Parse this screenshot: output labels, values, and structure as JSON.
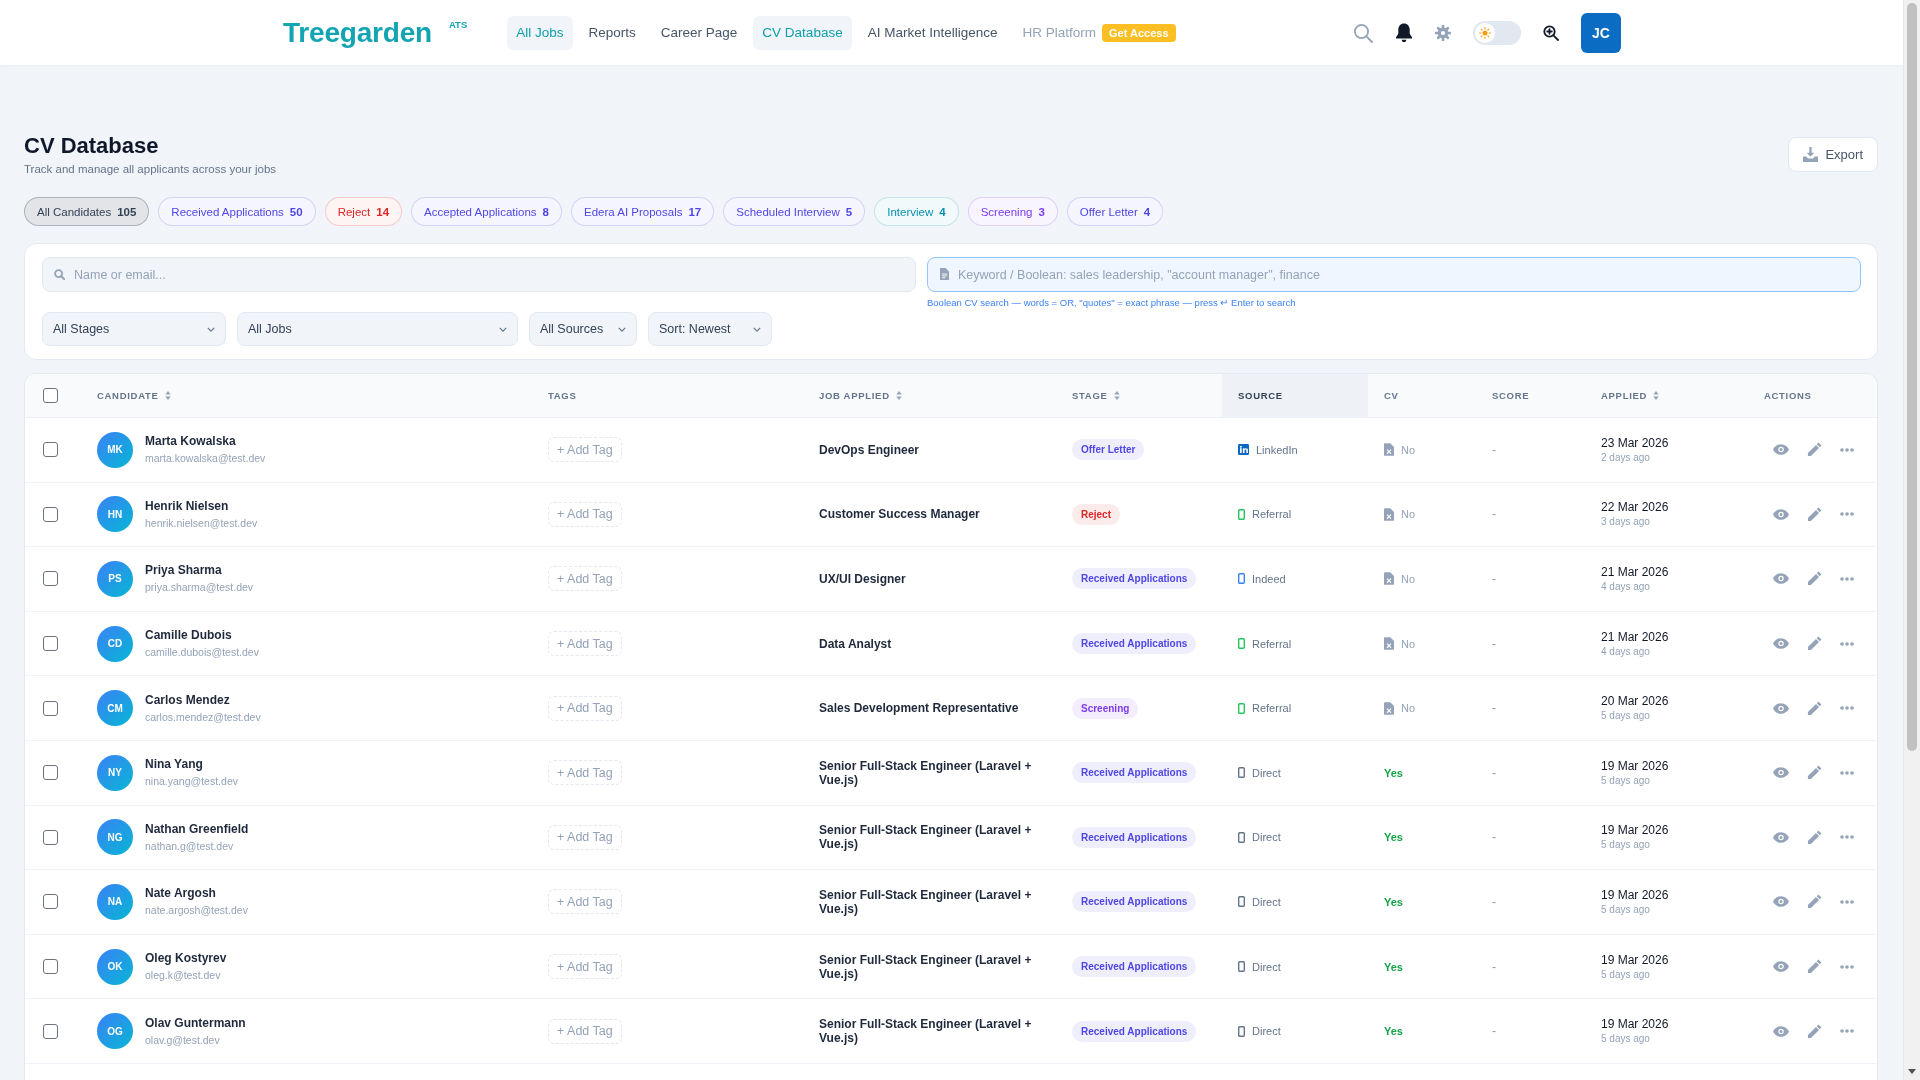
{
  "header": {
    "logo": "Treegarden",
    "logo_badge": "ATS",
    "nav": [
      {
        "label": "All Jobs",
        "selected": true,
        "disabled": false
      },
      {
        "label": "Reports",
        "selected": false,
        "disabled": false
      },
      {
        "label": "Career Page",
        "selected": false,
        "disabled": false
      },
      {
        "label": "CV Database",
        "selected": true,
        "disabled": false
      },
      {
        "label": "AI Market Intelligence",
        "selected": false,
        "disabled": false
      },
      {
        "label": "HR Platform",
        "selected": false,
        "disabled": true,
        "badge": "Get Access"
      }
    ],
    "theme_toggle": {
      "on": false
    },
    "user_initials": "JC"
  },
  "page": {
    "title": "CV Database",
    "subtitle": "Track and manage all applicants across your jobs",
    "export_button": "Export"
  },
  "stage_filters": [
    {
      "label": "All Candidates",
      "count": "105",
      "selected": true,
      "color": "#334155"
    },
    {
      "label": "Received Applications",
      "count": "50",
      "selected": false,
      "color": "#4f46e5"
    },
    {
      "label": "Reject",
      "count": "14",
      "selected": false,
      "color": "#dc2626"
    },
    {
      "label": "Accepted Applications",
      "count": "8",
      "selected": false,
      "color": "#4f46e5"
    },
    {
      "label": "Edera AI Proposals",
      "count": "17",
      "selected": false,
      "color": "#4f46e5"
    },
    {
      "label": "Scheduled Interview",
      "count": "5",
      "selected": false,
      "color": "#4f46e5"
    },
    {
      "label": "Interview",
      "count": "4",
      "selected": false,
      "color": "#0891b2"
    },
    {
      "label": "Screening",
      "count": "3",
      "selected": false,
      "color": "#7c3aed"
    },
    {
      "label": "Offer Letter",
      "count": "4",
      "selected": false,
      "color": "#4f46e5"
    }
  ],
  "filters": {
    "name_search": {
      "placeholder": "Name or email..."
    },
    "keyword_search": {
      "placeholder": "Keyword / Boolean: sales leadership, \"account manager\", finance",
      "hint": "Boolean CV search — words = OR, \"quotes\" = exact phrase — press ↵ Enter to search"
    },
    "dropdowns": [
      {
        "value": "All Stages"
      },
      {
        "value": "All Jobs"
      },
      {
        "value": "All Sources"
      },
      {
        "value": "Sort: Newest"
      }
    ]
  },
  "table": {
    "select_all": {
      "checked": false
    },
    "columns": [
      {
        "label": "CANDIDATE",
        "sortable": true,
        "highlighted": false
      },
      {
        "label": "TAGS",
        "sortable": false,
        "highlighted": false
      },
      {
        "label": "JOB APPLIED",
        "sortable": true,
        "highlighted": false
      },
      {
        "label": "STAGE",
        "sortable": true,
        "highlighted": false
      },
      {
        "label": "SOURCE",
        "sortable": false,
        "highlighted": true
      },
      {
        "label": "CV",
        "sortable": false,
        "highlighted": false
      },
      {
        "label": "SCORE",
        "sortable": false,
        "highlighted": false
      },
      {
        "label": "APPLIED",
        "sortable": true,
        "highlighted": false
      },
      {
        "label": "ACTIONS",
        "sortable": false,
        "highlighted": false
      }
    ],
    "rows": [
      {
        "checked": false,
        "initials": "MK",
        "name": "Marta Kowalska",
        "email": "marta.kowalska@test.dev",
        "tag_action": "+ Add Tag",
        "job": "DevOps Engineer",
        "stage": {
          "label": "Offer Letter",
          "color": "#4f46e5"
        },
        "source": {
          "label": "LinkedIn",
          "kind": "linkedin",
          "color": "#0a66c2"
        },
        "cv": {
          "label": "No",
          "attached": false
        },
        "score": "-",
        "applied_date": "23 Mar 2026",
        "applied_ago": "2 days ago"
      },
      {
        "checked": false,
        "initials": "HN",
        "name": "Henrik Nielsen",
        "email": "henrik.nielsen@test.dev",
        "tag_action": "+ Add Tag",
        "job": "Customer Success Manager",
        "stage": {
          "label": "Reject",
          "color": "#dc2626"
        },
        "source": {
          "label": "Referral",
          "kind": "device",
          "color": "#22c55e"
        },
        "cv": {
          "label": "No",
          "attached": false
        },
        "score": "-",
        "applied_date": "22 Mar 2026",
        "applied_ago": "3 days ago"
      },
      {
        "checked": false,
        "initials": "PS",
        "name": "Priya Sharma",
        "email": "priya.sharma@test.dev",
        "tag_action": "+ Add Tag",
        "job": "UX/UI Designer",
        "stage": {
          "label": "Received Applications",
          "color": "#4f46e5"
        },
        "source": {
          "label": "Indeed",
          "kind": "device",
          "color": "#3b82f6"
        },
        "cv": {
          "label": "No",
          "attached": false
        },
        "score": "-",
        "applied_date": "21 Mar 2026",
        "applied_ago": "4 days ago"
      },
      {
        "checked": false,
        "initials": "CD",
        "name": "Camille Dubois",
        "email": "camille.dubois@test.dev",
        "tag_action": "+ Add Tag",
        "job": "Data Analyst",
        "stage": {
          "label": "Received Applications",
          "color": "#4f46e5"
        },
        "source": {
          "label": "Referral",
          "kind": "device",
          "color": "#22c55e"
        },
        "cv": {
          "label": "No",
          "attached": false
        },
        "score": "-",
        "applied_date": "21 Mar 2026",
        "applied_ago": "4 days ago"
      },
      {
        "checked": false,
        "initials": "CM",
        "name": "Carlos Mendez",
        "email": "carlos.mendez@test.dev",
        "tag_action": "+ Add Tag",
        "job": "Sales Development Representative",
        "stage": {
          "label": "Screening",
          "color": "#7c3aed"
        },
        "source": {
          "label": "Referral",
          "kind": "device",
          "color": "#22c55e"
        },
        "cv": {
          "label": "No",
          "attached": false
        },
        "score": "-",
        "applied_date": "20 Mar 2026",
        "applied_ago": "5 days ago"
      },
      {
        "checked": false,
        "initials": "NY",
        "name": "Nina Yang",
        "email": "nina.yang@test.dev",
        "tag_action": "+ Add Tag",
        "job": "Senior Full-Stack Engineer (Laravel + Vue.js)",
        "stage": {
          "label": "Received Applications",
          "color": "#4f46e5"
        },
        "source": {
          "label": "Direct",
          "kind": "device",
          "color": "#64748b"
        },
        "cv": {
          "label": "Yes",
          "attached": true
        },
        "score": "-",
        "applied_date": "19 Mar 2026",
        "applied_ago": "5 days ago"
      },
      {
        "checked": false,
        "initials": "NG",
        "name": "Nathan Greenfield",
        "email": "nathan.g@test.dev",
        "tag_action": "+ Add Tag",
        "job": "Senior Full-Stack Engineer (Laravel + Vue.js)",
        "stage": {
          "label": "Received Applications",
          "color": "#4f46e5"
        },
        "source": {
          "label": "Direct",
          "kind": "device",
          "color": "#64748b"
        },
        "cv": {
          "label": "Yes",
          "attached": true
        },
        "score": "-",
        "applied_date": "19 Mar 2026",
        "applied_ago": "5 days ago"
      },
      {
        "checked": false,
        "initials": "NA",
        "name": "Nate Argosh",
        "email": "nate.argosh@test.dev",
        "tag_action": "+ Add Tag",
        "job": "Senior Full-Stack Engineer (Laravel + Vue.js)",
        "stage": {
          "label": "Received Applications",
          "color": "#4f46e5"
        },
        "source": {
          "label": "Direct",
          "kind": "device",
          "color": "#64748b"
        },
        "cv": {
          "label": "Yes",
          "attached": true
        },
        "score": "-",
        "applied_date": "19 Mar 2026",
        "applied_ago": "5 days ago"
      },
      {
        "checked": false,
        "initials": "OK",
        "name": "Oleg Kostyrev",
        "email": "oleg.k@test.dev",
        "tag_action": "+ Add Tag",
        "job": "Senior Full-Stack Engineer (Laravel + Vue.js)",
        "stage": {
          "label": "Received Applications",
          "color": "#4f46e5"
        },
        "source": {
          "label": "Direct",
          "kind": "device",
          "color": "#64748b"
        },
        "cv": {
          "label": "Yes",
          "attached": true
        },
        "score": "-",
        "applied_date": "19 Mar 2026",
        "applied_ago": "5 days ago"
      },
      {
        "checked": false,
        "initials": "OG",
        "name": "Olav Guntermann",
        "email": "olav.g@test.dev",
        "tag_action": "+ Add Tag",
        "job": "Senior Full-Stack Engineer (Laravel + Vue.js)",
        "stage": {
          "label": "Received Applications",
          "color": "#4f46e5"
        },
        "source": {
          "label": "Direct",
          "kind": "device",
          "color": "#64748b"
        },
        "cv": {
          "label": "Yes",
          "attached": true
        },
        "score": "-",
        "applied_date": "19 Mar 2026",
        "applied_ago": "5 days ago"
      }
    ]
  }
}
